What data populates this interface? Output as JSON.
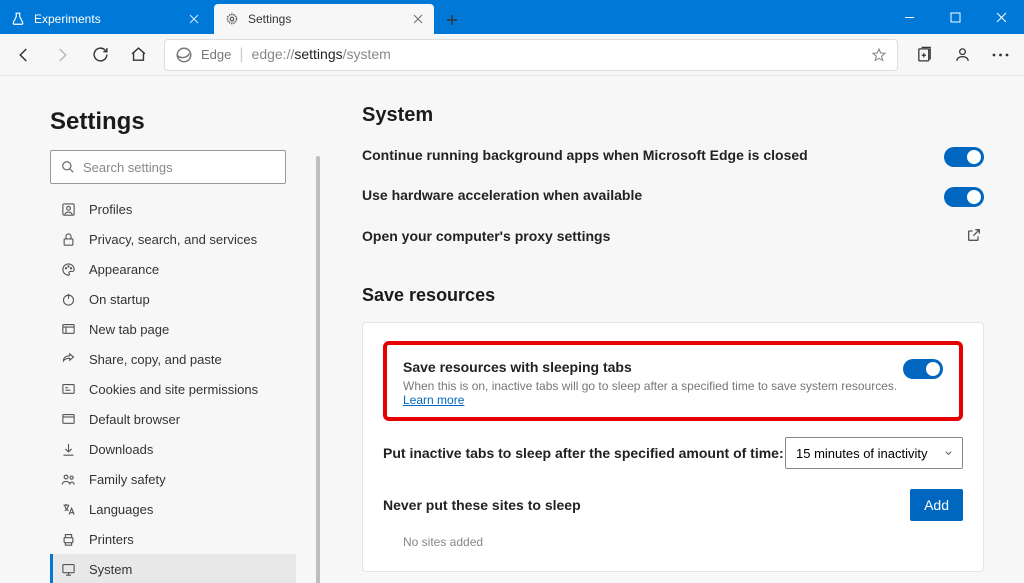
{
  "tabs": {
    "inactive_label": "Experiments",
    "active_label": "Settings"
  },
  "toolbar": {
    "site_label": "Edge",
    "url_scheme": "edge://",
    "url_path1": "settings",
    "url_path2": "/system"
  },
  "sidebar": {
    "heading": "Settings",
    "search_placeholder": "Search settings",
    "items": [
      {
        "label": "Profiles"
      },
      {
        "label": "Privacy, search, and services"
      },
      {
        "label": "Appearance"
      },
      {
        "label": "On startup"
      },
      {
        "label": "New tab page"
      },
      {
        "label": "Share, copy, and paste"
      },
      {
        "label": "Cookies and site permissions"
      },
      {
        "label": "Default browser"
      },
      {
        "label": "Downloads"
      },
      {
        "label": "Family safety"
      },
      {
        "label": "Languages"
      },
      {
        "label": "Printers"
      },
      {
        "label": "System"
      }
    ]
  },
  "main": {
    "system_heading": "System",
    "row_bg_apps": "Continue running background apps when Microsoft Edge is closed",
    "row_hw_accel": "Use hardware acceleration when available",
    "row_proxy": "Open your computer's proxy settings",
    "save_heading": "Save resources",
    "sleep_title": "Save resources with sleeping tabs",
    "sleep_desc": "When this is on, inactive tabs will go to sleep after a specified time to save system resources. ",
    "learn_more": "Learn more",
    "inactive_label": "Put inactive tabs to sleep after the specified amount of time:",
    "inactive_value": "15 minutes of inactivity",
    "never_label": "Never put these sites to sleep",
    "add_label": "Add",
    "no_sites": "No sites added"
  }
}
